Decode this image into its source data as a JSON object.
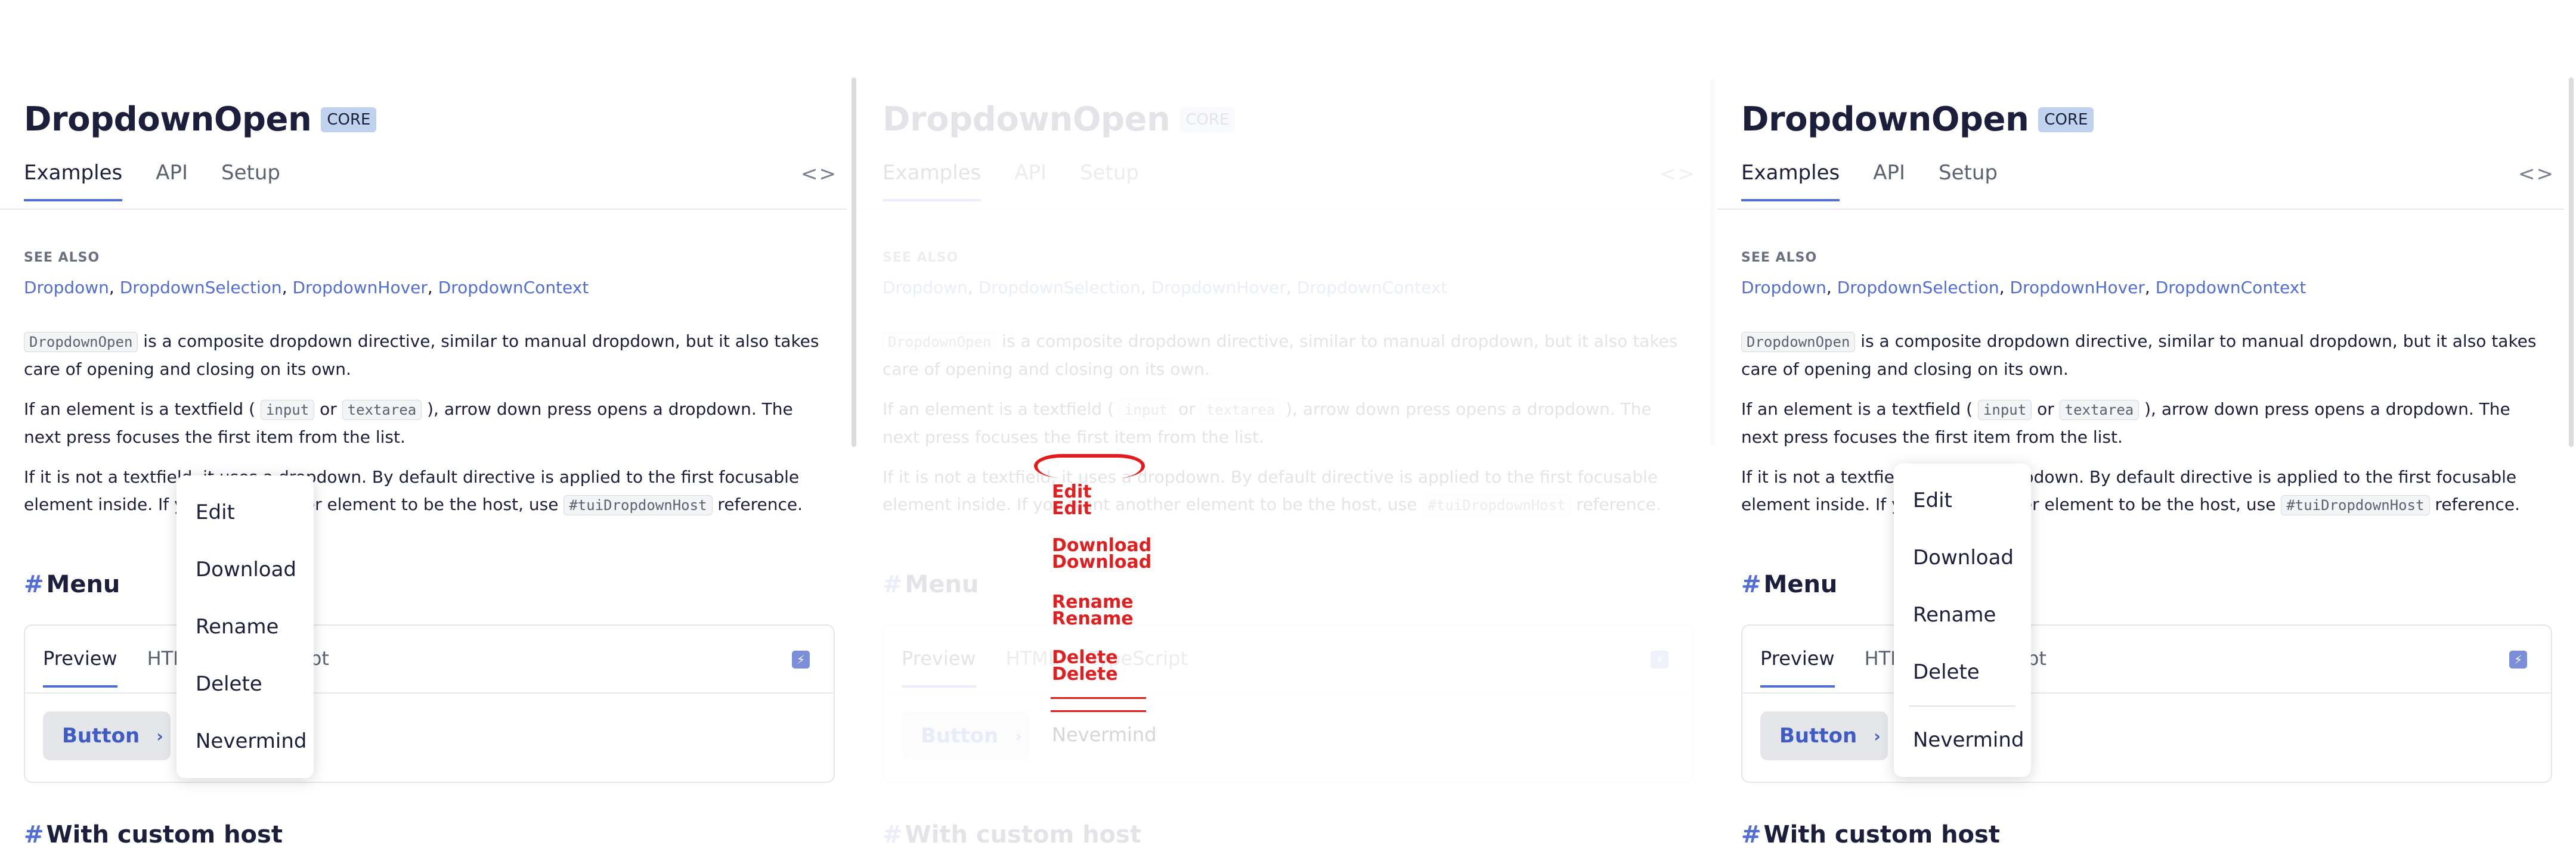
{
  "page": {
    "title": "DropdownOpen",
    "badge": "CORE",
    "tabs": [
      "Examples",
      "API",
      "Setup"
    ],
    "code_toggle": "<>",
    "see_also_label": "SEE ALSO",
    "see_also_links": [
      "Dropdown",
      "DropdownSelection",
      "DropdownHover",
      "DropdownContext"
    ],
    "para1": {
      "code": "DropdownOpen",
      "text": " is a composite dropdown directive, similar to manual dropdown, but it also takes care of opening and closing on its own."
    },
    "para2": {
      "t1": "If an element is a textfield ( ",
      "code1": "input",
      "t2": " or ",
      "code2": "textarea",
      "t3": " ), arrow down press opens a dropdown. The next press focuses the first item from the list."
    },
    "para3": {
      "t1": "If it is not a textfield, it uses a dropdown. By default directive is applied to the first focusable element inside. If you want another element to be the host, use ",
      "code": "#tuiDropdownHost",
      "t2": " reference."
    },
    "section_menu": "Menu",
    "section_custom_host": "With custom host",
    "hash": "#",
    "preview_tabs": [
      "Preview",
      "HTML",
      "TypeScript"
    ],
    "demo_button": "Button",
    "bolt_icon": "lightning-icon"
  },
  "dropdown": {
    "items": [
      "Edit",
      "Download",
      "Rename",
      "Delete"
    ],
    "last_item": "Nevermind"
  },
  "colors": {
    "accent": "#526ed3",
    "badge_bg": "#bfd3ee",
    "glitch_red": "#e31b1b",
    "glitch_orange": "#f08a00"
  }
}
